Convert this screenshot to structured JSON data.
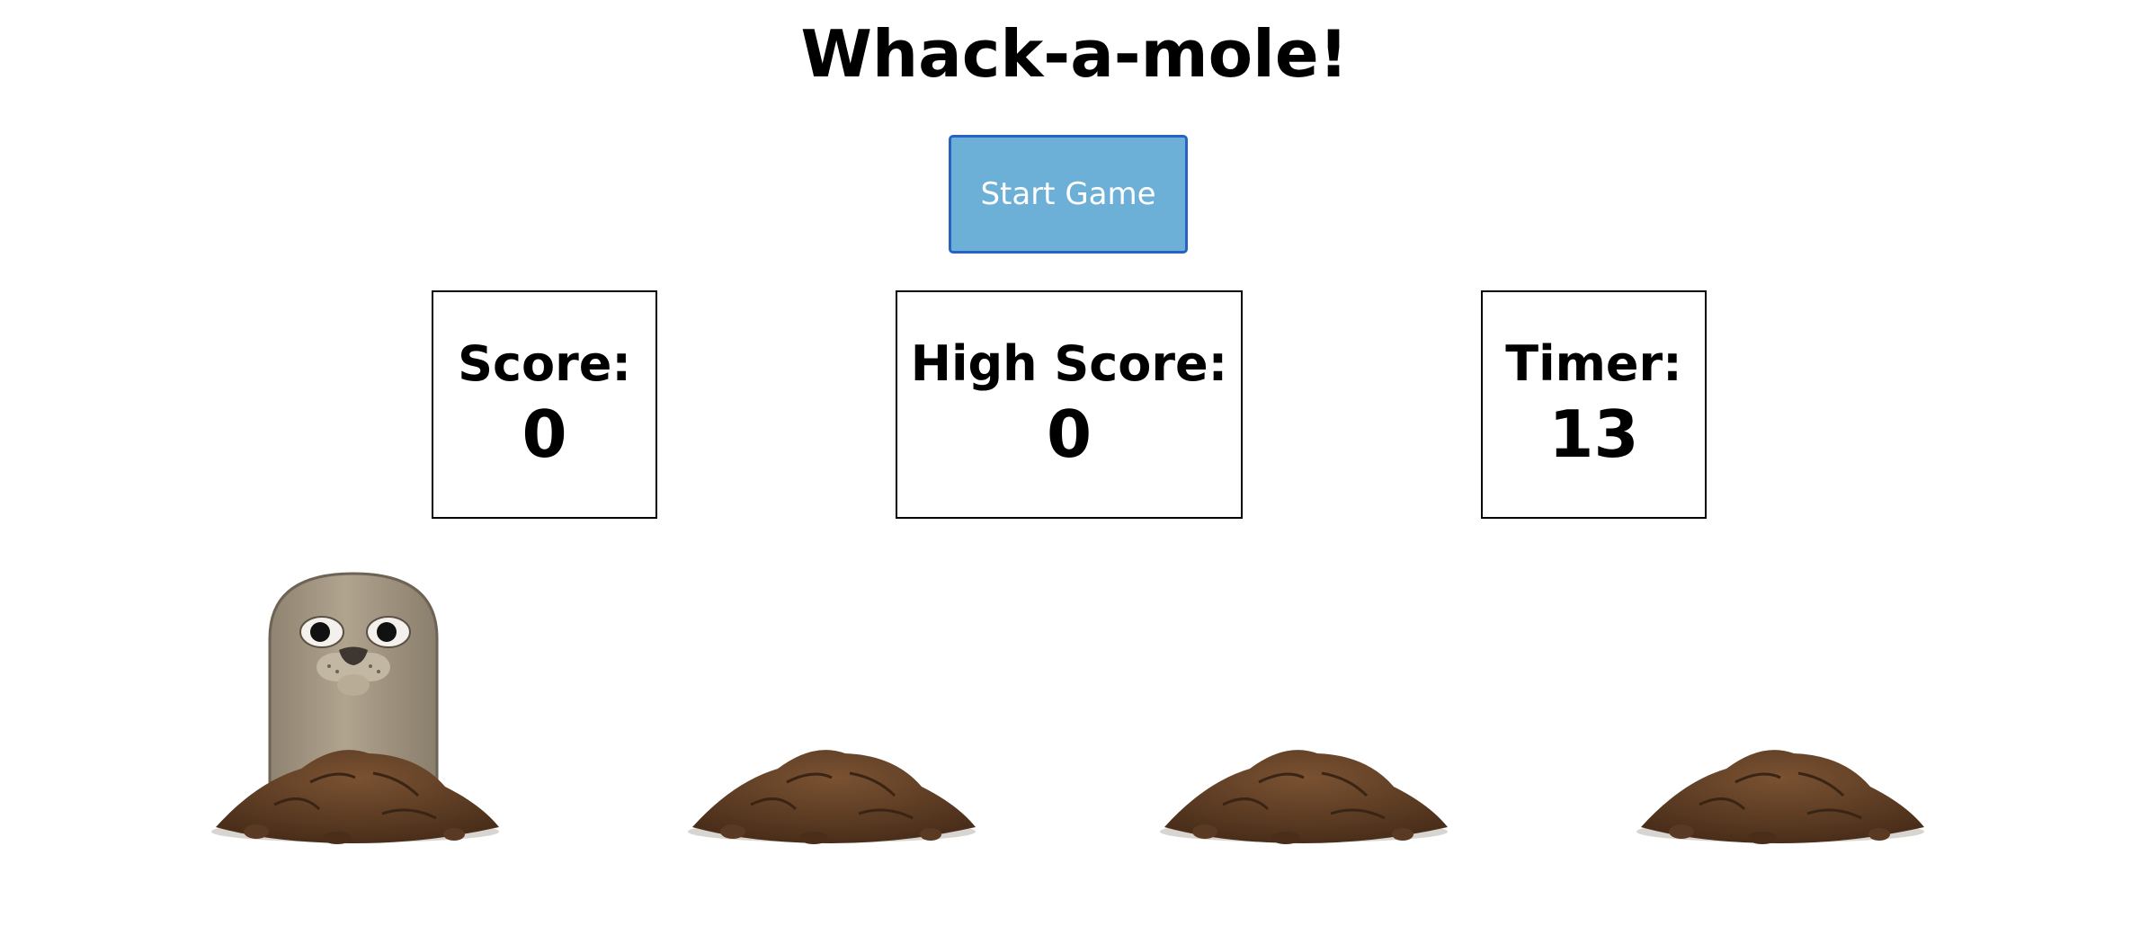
{
  "title": "Whack-a-mole!",
  "controls": {
    "start_label": "Start Game"
  },
  "stats": {
    "score_label": "Score:",
    "score_value": "0",
    "high_score_label": "High Score:",
    "high_score_value": "0",
    "timer_label": "Timer:",
    "timer_value": "13"
  },
  "holes": [
    {
      "id": 1,
      "mole_visible": true,
      "icon": "seal-mole-icon"
    },
    {
      "id": 2,
      "mole_visible": false,
      "icon": "dirt-mound-icon"
    },
    {
      "id": 3,
      "mole_visible": false,
      "icon": "dirt-mound-icon"
    },
    {
      "id": 4,
      "mole_visible": false,
      "icon": "dirt-mound-icon"
    }
  ],
  "colors": {
    "button_bg": "#6cb0d8",
    "button_border": "#2763c3",
    "dirt": "#5a3a22",
    "mole": "#a69884"
  }
}
